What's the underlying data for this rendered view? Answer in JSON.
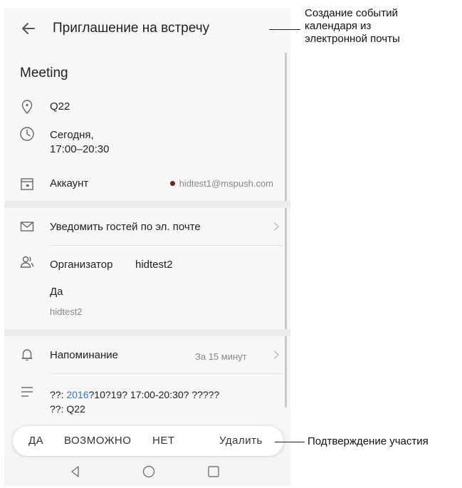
{
  "header": {
    "title": "Приглашение на встречу"
  },
  "event": {
    "title": "Meeting",
    "location": "Q22",
    "time_line1": "Сегодня,",
    "time_line2": "17:00–20:30",
    "account_label": "Аккаунт",
    "account_value": "hidtest1@mspush.com",
    "notify_label": "Уведомить гостей по эл. почте",
    "organizer_label": "Организатор",
    "organizer_name": "hidtest2",
    "response": "Да",
    "response_user": "hidtest2",
    "reminder_label": "Напоминание",
    "reminder_value": "За 15 минут",
    "desc_prefix": "??: ",
    "desc_link": "2016",
    "desc_rest": "?10?19? 17:00-20:30? ?????",
    "desc_line2": "??: Q22"
  },
  "actions": {
    "yes": "ДА",
    "maybe": "ВОЗМОЖНО",
    "no": "НЕТ",
    "delete": "Удалить"
  },
  "annotations": {
    "calendar_from_email_1": "Создание событий",
    "calendar_from_email_2": "календаря из",
    "calendar_from_email_3": "электронной почты",
    "rsvp": "Подтверждение участия"
  },
  "colors": {
    "accent_link": "#2b7bd4",
    "account_dot": "#7a1d1d"
  }
}
